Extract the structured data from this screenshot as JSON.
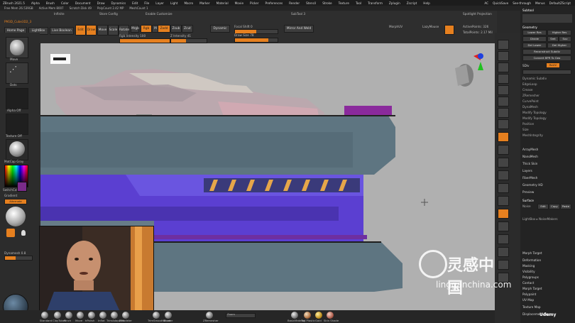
{
  "menubar": {
    "title": "ZBrush 2021.5",
    "items": [
      "Alpha",
      "Brush",
      "Color",
      "Document",
      "Draw",
      "Dynamics",
      "Edit",
      "File",
      "Layer",
      "Light",
      "Macro",
      "Marker",
      "Material",
      "Movie",
      "Picker",
      "Preferences",
      "Render",
      "Stencil",
      "Stroke",
      "Texture",
      "Tool",
      "Transform",
      "Zplugin",
      "Zscript",
      "Help"
    ],
    "right": [
      "AC",
      "QuickSave",
      "See-through",
      "Menus",
      "DefaultZScript"
    ]
  },
  "stats": [
    "Free Mem 26.539GB",
    "Active Mem 8007",
    "Scratch Disk 49",
    "PolyCount 2.42 MP",
    "MeshCount 1"
  ],
  "shelf": {
    "buttons": [
      "Home Page",
      "LightBox",
      "Live Boolean",
      "Edit",
      "Draw",
      "Move",
      "Scale",
      "Rotate"
    ],
    "mrgb": "Mrgb",
    "rgb": "Rgb",
    "m": "M",
    "zadd": "Zadd",
    "zsub": "Zsub",
    "zcut": "Zcut",
    "focal_label": "Focal Shift 0",
    "draw_size_label": "Draw Size 78",
    "dynamic": "Dynamic",
    "rgb_intensity": "Rgb Intensity 100",
    "z_intensity": "Z Intensity 41",
    "active_points": "ActivePoints: 326",
    "total_points": "TotalPoints: 2.17 Mil",
    "spotlight": "Spotlight Projection",
    "mirror_weld": "Mirror And Weld",
    "enable_customize": "Enable Customize",
    "infinite_label": "Infinite",
    "store_config": "Store Config",
    "morph_ub": "MorphUV",
    "weld": "SubTool 3",
    "lazy_mouse": "LazyMouse",
    "brush_name": "PM3D_Cube3D2_3"
  },
  "leftbar": {
    "brushes": [
      "Move",
      "Dots",
      "Alpha Off",
      "Texture Off",
      "MatCap Gray",
      "SwitchColor",
      "Gradient",
      "Alternate"
    ],
    "dynamesh": "Dynamesh 0.8"
  },
  "bottombar": {
    "items": [
      "Standard",
      "ClayTubes",
      "Pinch",
      "Move",
      "hPolish",
      "Inflat",
      "TrimAdaptive",
      "ZModeler",
      "hPolish",
      "TrimSmoothBorder",
      "ZRemesher",
      "Move"
    ],
    "zoom_label": "Zoom",
    "materials": [
      "BasicMaterial",
      "Toy Plastic",
      "Gold",
      "Skin Shade"
    ]
  },
  "rightpanel": {
    "header": [
      "Subtool",
      "Geometry",
      "ArrayMesh",
      "NanoMesh",
      "Thick Skin",
      "Layers",
      "FiberMesh",
      "Geometry HD",
      "Preview",
      "Surface",
      "Deformation",
      "Masking",
      "Visibility",
      "Polygroups",
      "Contact",
      "Morph Target",
      "Polypaint",
      "UV Map",
      "Texture Map",
      "Displacement Map"
    ],
    "geometry_items": [
      "Lower Res",
      "Higher Res",
      "Divide",
      "Del Lower",
      "Del Higher",
      "Reconstruct Subdiv",
      "Convert BPR To Geo",
      "Crease",
      "ZRemesher",
      "Modify Topology",
      "Position",
      "Size",
      "MeshIntegrity",
      "Dynamic Subdiv",
      "EdgeLoop",
      "CurvePoint",
      "DynaMesh"
    ],
    "sdiv_label": "SDiv",
    "smt": "Smt",
    "suv": "Suv",
    "reuv": "ReUV",
    "noise": "Noise",
    "edit": "Edit",
    "copy": "Copy",
    "paste": "Paste",
    "lightbox_noise": "LightBox ▸ NoiseMakers",
    "morph_label": "Morph Target",
    "extract_label": "Extract",
    "udemy": "Udemy",
    "watermark_cn": "灵感中国",
    "watermark_url": "lingganchina.com"
  },
  "colors": {
    "accent": "#e6801f",
    "gun_blue": "#5b3fd1",
    "gun_gray": "#5f7480",
    "canvas_bg": "#b0b0b0"
  }
}
